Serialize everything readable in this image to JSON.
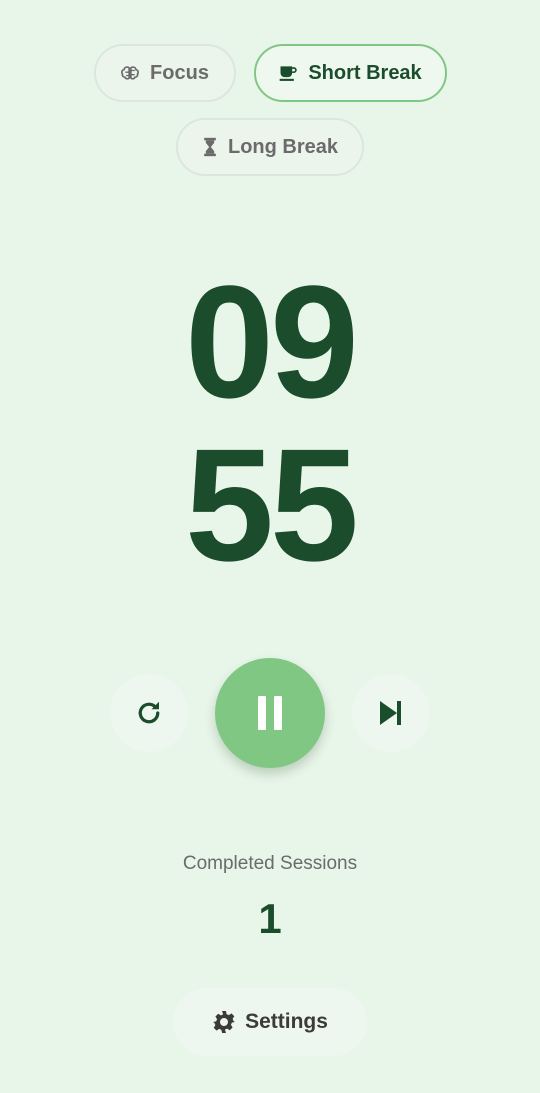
{
  "modes": {
    "focus": {
      "label": "Focus",
      "icon": "brain-icon"
    },
    "short_break": {
      "label": "Short Break",
      "icon": "coffee-cup-icon",
      "active": true
    },
    "long_break": {
      "label": "Long Break",
      "icon": "hourglass-icon"
    }
  },
  "timer": {
    "minutes": "09",
    "seconds": "55"
  },
  "controls": {
    "reset_icon": "refresh-icon",
    "pause_icon": "pause-icon",
    "skip_icon": "skip-next-icon"
  },
  "sessions": {
    "label": "Completed Sessions",
    "count": "1"
  },
  "settings": {
    "label": "Settings",
    "icon": "gear-icon"
  },
  "colors": {
    "background": "#e8f5e9",
    "accent": "#81c784",
    "dark_green": "#1b4d2c",
    "muted_text": "#6b6b6b"
  }
}
